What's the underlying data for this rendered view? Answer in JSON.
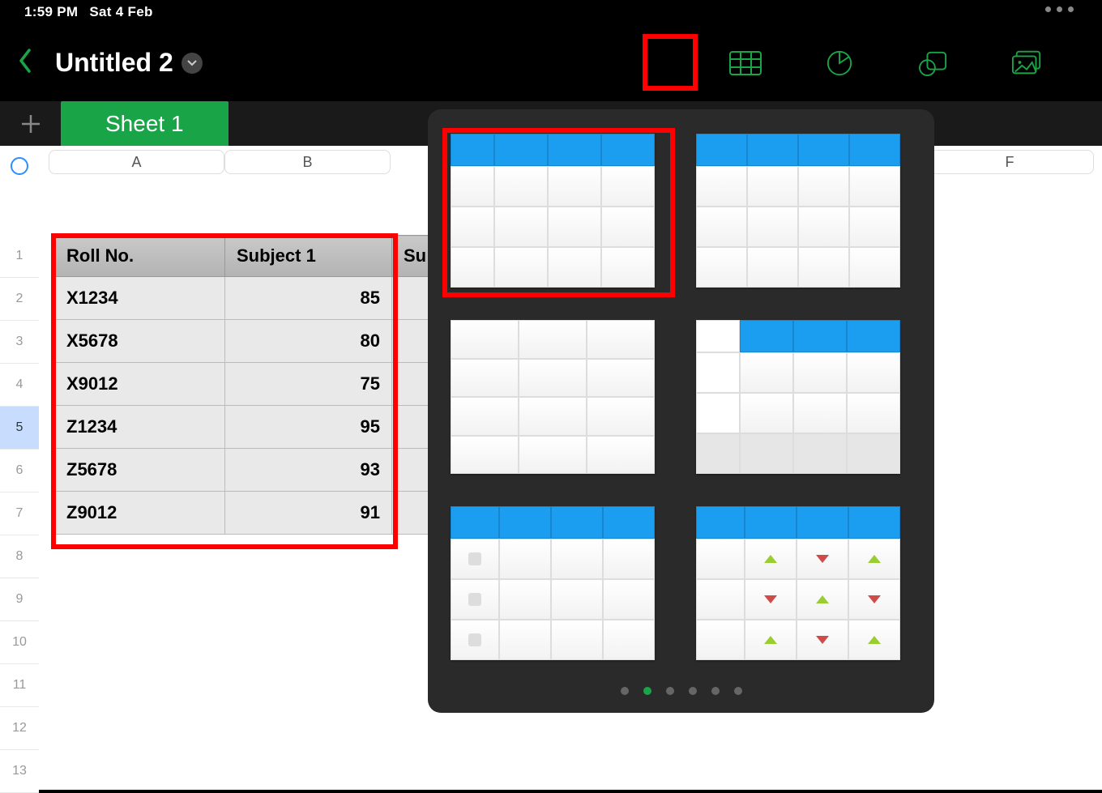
{
  "status": {
    "time": "1:59 PM",
    "date": "Sat 4 Feb"
  },
  "document": {
    "title": "Untitled 2"
  },
  "sheet_tabs": {
    "active": "Sheet 1"
  },
  "columns": [
    "A",
    "B",
    "F"
  ],
  "row_numbers": [
    1,
    2,
    3,
    4,
    5,
    6,
    7,
    8,
    9,
    10,
    11,
    12,
    13
  ],
  "selected_row": 5,
  "table": {
    "headers": [
      "Roll No.",
      "Subject 1",
      "Su"
    ],
    "rows": [
      {
        "roll": "X1234",
        "s1": 85
      },
      {
        "roll": "X5678",
        "s1": 80
      },
      {
        "roll": "X9012",
        "s1": 75
      },
      {
        "roll": "Z1234",
        "s1": 95
      },
      {
        "roll": "Z5678",
        "s1": 93
      },
      {
        "roll": "Z9012",
        "s1": 91
      }
    ]
  },
  "toolbar_icons": [
    "table-icon",
    "chart-icon",
    "shape-icon",
    "media-icon"
  ],
  "popup": {
    "pager_count": 6,
    "pager_active": 1
  }
}
